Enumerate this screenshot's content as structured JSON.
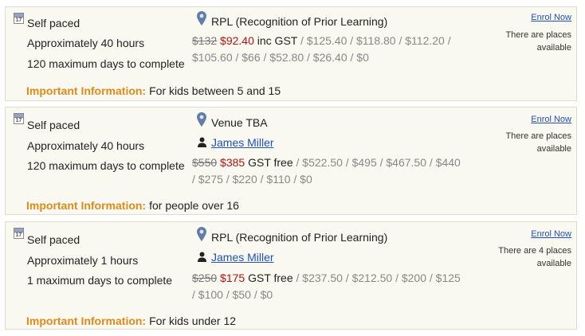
{
  "courses": [
    {
      "pace": "Self paced",
      "duration": "Approximately 40 hours",
      "max_days": "120 maximum days to complete",
      "location": "RPL (Recognition of Prior Learning)",
      "trainer": null,
      "price_original": "$132",
      "price_sale": "$92.40",
      "gst_label": "inc GST",
      "price_tiers_line1": "/ $125.40 / $118.80 / $112.20 /",
      "price_tiers_line2": "$105.60 / $66 / $52.80 / $26.40 / $0",
      "enrol_label": "Enrol Now",
      "places": "There are places available",
      "important_label": "Important Information:",
      "important_text": "For kids between 5 and 15"
    },
    {
      "pace": "Self paced",
      "duration": "Approximately 40 hours",
      "max_days": "120 maximum days to complete",
      "location": "Venue TBA",
      "trainer": "James Miller",
      "price_original": "$550",
      "price_sale": "$385",
      "gst_label": "GST free",
      "price_tiers_line1": "/ $522.50 / $495 / $467.50 / $440",
      "price_tiers_line2": "/ $275 / $220 / $110 / $0",
      "enrol_label": "Enrol Now",
      "places": "There are places available",
      "important_label": "Important Information:",
      "important_text": "for people over 16"
    },
    {
      "pace": "Self paced",
      "duration": "Approximately 1 hours",
      "max_days": "1 maximum days to complete",
      "location": "RPL (Recognition of Prior Learning)",
      "trainer": "James Miller",
      "price_original": "$250",
      "price_sale": "$175",
      "gst_label": "GST free",
      "price_tiers_line1": "/ $237.50 / $212.50 / $200 / $125",
      "price_tiers_line2": "/ $100 / $50 / $0",
      "enrol_label": "Enrol Now",
      "places": "There are 4 places available",
      "important_label": "Important Information:",
      "important_text": "For kids under 12"
    }
  ],
  "calendar_icon_day": "17",
  "icons": {
    "calendar": "calendar-icon",
    "location": "map-pin-icon",
    "trainer": "person-icon"
  },
  "colors": {
    "sale": "#b0130e",
    "important": "#e08a1a",
    "link": "#1f4fb8"
  }
}
